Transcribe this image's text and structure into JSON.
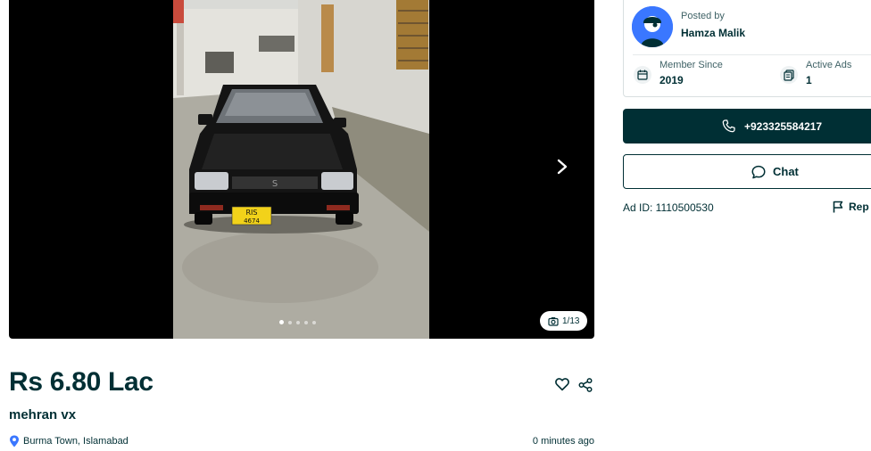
{
  "gallery": {
    "counter": "1/13",
    "slide_count": 5,
    "active_slide": 1,
    "plate_text_top": "RIS",
    "plate_text_bottom": "4674"
  },
  "listing": {
    "price": "Rs 6.80 Lac",
    "title": "mehran vx",
    "location": "Burma Town, Islamabad",
    "posted_time": "0 minutes ago"
  },
  "seller": {
    "posted_by_label": "Posted by",
    "name": "Hamza Malik",
    "member_since_label": "Member Since",
    "member_since_value": "2019",
    "active_ads_label": "Active Ads",
    "active_ads_value": "1"
  },
  "actions": {
    "phone": "+923325584217",
    "chat_label": "Chat",
    "ad_id": "Ad ID: 1110500530",
    "report_label": "Rep"
  },
  "colors": {
    "primary": "#002f34",
    "avatar_bg": "#3a77ff"
  }
}
